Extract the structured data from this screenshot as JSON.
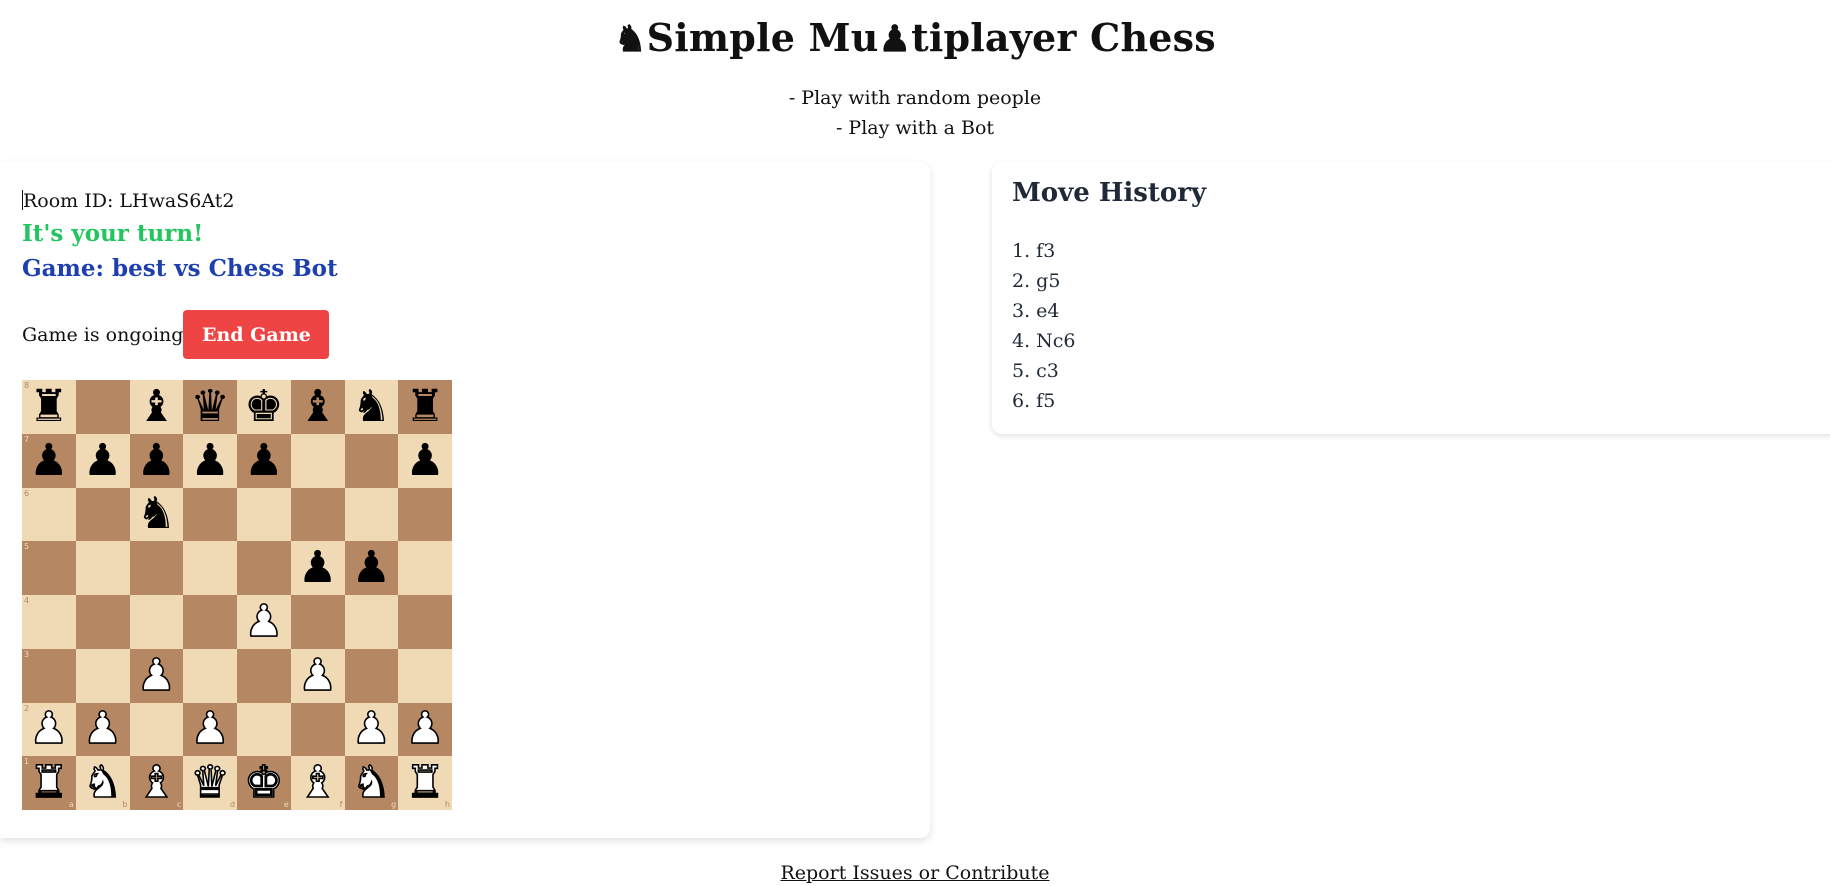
{
  "header": {
    "title": "Simple Mu tiplayer Chess",
    "title_icon": "black-knight-icon",
    "title_inline_icon": "black-pawn-icon",
    "subtitles": [
      "- Play with random people",
      "- Play with a Bot"
    ]
  },
  "game": {
    "room_id_text": "Room ID: LHwaS6At2",
    "turn_text": "It's your turn!",
    "game_text": "Game: best vs Chess Bot",
    "status_text": "Game is ongoing",
    "end_button_label": "End Game"
  },
  "board": {
    "ranks": [
      "8",
      "7",
      "6",
      "5",
      "4",
      "3",
      "2",
      "1"
    ],
    "files": [
      "a",
      "b",
      "c",
      "d",
      "e",
      "f",
      "g",
      "h"
    ],
    "position": [
      [
        "r",
        "",
        "b",
        "q",
        "k",
        "b",
        "n",
        "r"
      ],
      [
        "p",
        "p",
        "p",
        "p",
        "p",
        "",
        "",
        "p"
      ],
      [
        "",
        "",
        "n",
        "",
        "",
        "",
        "",
        ""
      ],
      [
        "",
        "",
        "",
        "",
        "",
        "p",
        "p",
        ""
      ],
      [
        "",
        "",
        "",
        "",
        "P",
        "",
        "",
        ""
      ],
      [
        "",
        "",
        "P",
        "",
        "",
        "P",
        "",
        ""
      ],
      [
        "P",
        "P",
        "",
        "P",
        "",
        "",
        "P",
        "P"
      ],
      [
        "R",
        "N",
        "B",
        "Q",
        "K",
        "B",
        "N",
        "R"
      ]
    ],
    "light_color": "#f0d9b5",
    "dark_color": "#b58863"
  },
  "move_history": {
    "title": "Move History",
    "moves": [
      "1. f3",
      "2. g5",
      "3. e4",
      "4. Nc6",
      "5. c3",
      "6. f5"
    ]
  },
  "footer": {
    "report_link": "Report Issues or Contribute"
  },
  "colors": {
    "turn_green": "#22c55e",
    "game_blue": "#1e40af",
    "end_button_red": "#ef4444"
  }
}
